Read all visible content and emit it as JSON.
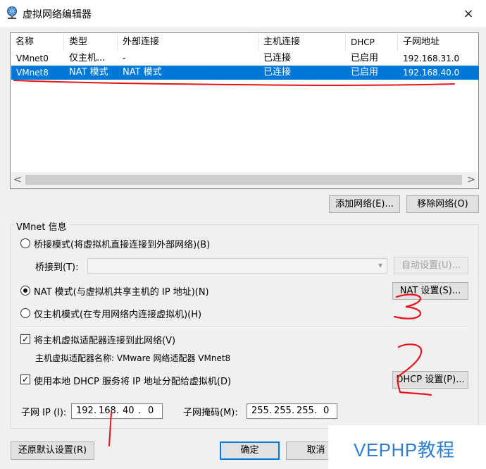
{
  "window": {
    "title": "虚拟网络编辑器",
    "close_icon": "×"
  },
  "table": {
    "columns": [
      "名称",
      "类型",
      "外部连接",
      "主机连接",
      "DHCP",
      "子网地址"
    ],
    "rows": [
      {
        "name": "VMnet0",
        "type": "仅主机...",
        "external": "-",
        "host": "已连接",
        "dhcp": "已启用",
        "subnet": "192.168.31.0"
      },
      {
        "name": "VMnet8",
        "type": "NAT 模式",
        "external": "NAT 模式",
        "host": "已连接",
        "dhcp": "已启用",
        "subnet": "192.168.40.0",
        "selected": true
      }
    ],
    "scroll_left": "<",
    "scroll_right": ">"
  },
  "buttons": {
    "add_network": "添加网络(E)...",
    "remove_network": "移除网络(O)",
    "auto_settings": "自动设置(U)...",
    "nat_settings": "NAT 设置(S)...",
    "dhcp_settings": "DHCP 设置(P)...",
    "restore_defaults": "还原默认设置(R)",
    "ok": "确定",
    "cancel": "取消"
  },
  "vmnet_info": {
    "group_title": "VMnet 信息",
    "bridged_mode": "桥接模式(将虚拟机直接连接到外部网络)(B)",
    "bridged_to_label": "桥接到(T):",
    "bridged_to_value": "",
    "nat_mode": "NAT 模式(与虚拟机共享主机的 IP 地址)(N)",
    "host_only_mode": "仅主机模式(在专用网络内连接虚拟机)(H)",
    "selected_mode": "nat",
    "connect_host_adapter": "将主机虚拟适配器连接到此网络(V)",
    "connect_host_adapter_checked": true,
    "host_adapter_name": "主机虚拟适配器名称: VMware 网络适配器 VMnet8",
    "use_local_dhcp": "使用本地 DHCP 服务将 IP 地址分配给虚拟机(D)",
    "use_local_dhcp_checked": true,
    "subnet_ip_label": "子网 IP (I):",
    "subnet_ip": [
      "192",
      "168",
      "40",
      "0"
    ],
    "subnet_mask_label": "子网掩码(M):",
    "subnet_mask": [
      "255",
      "255",
      "255",
      "0"
    ]
  },
  "annotations": {
    "mark_3": "3",
    "mark_2": "2"
  },
  "watermark": {
    "text": "VEPHP教程"
  },
  "colors": {
    "selection": "#0078d7",
    "annotation": "#e8141b",
    "watermark": "#2f7fd0"
  }
}
